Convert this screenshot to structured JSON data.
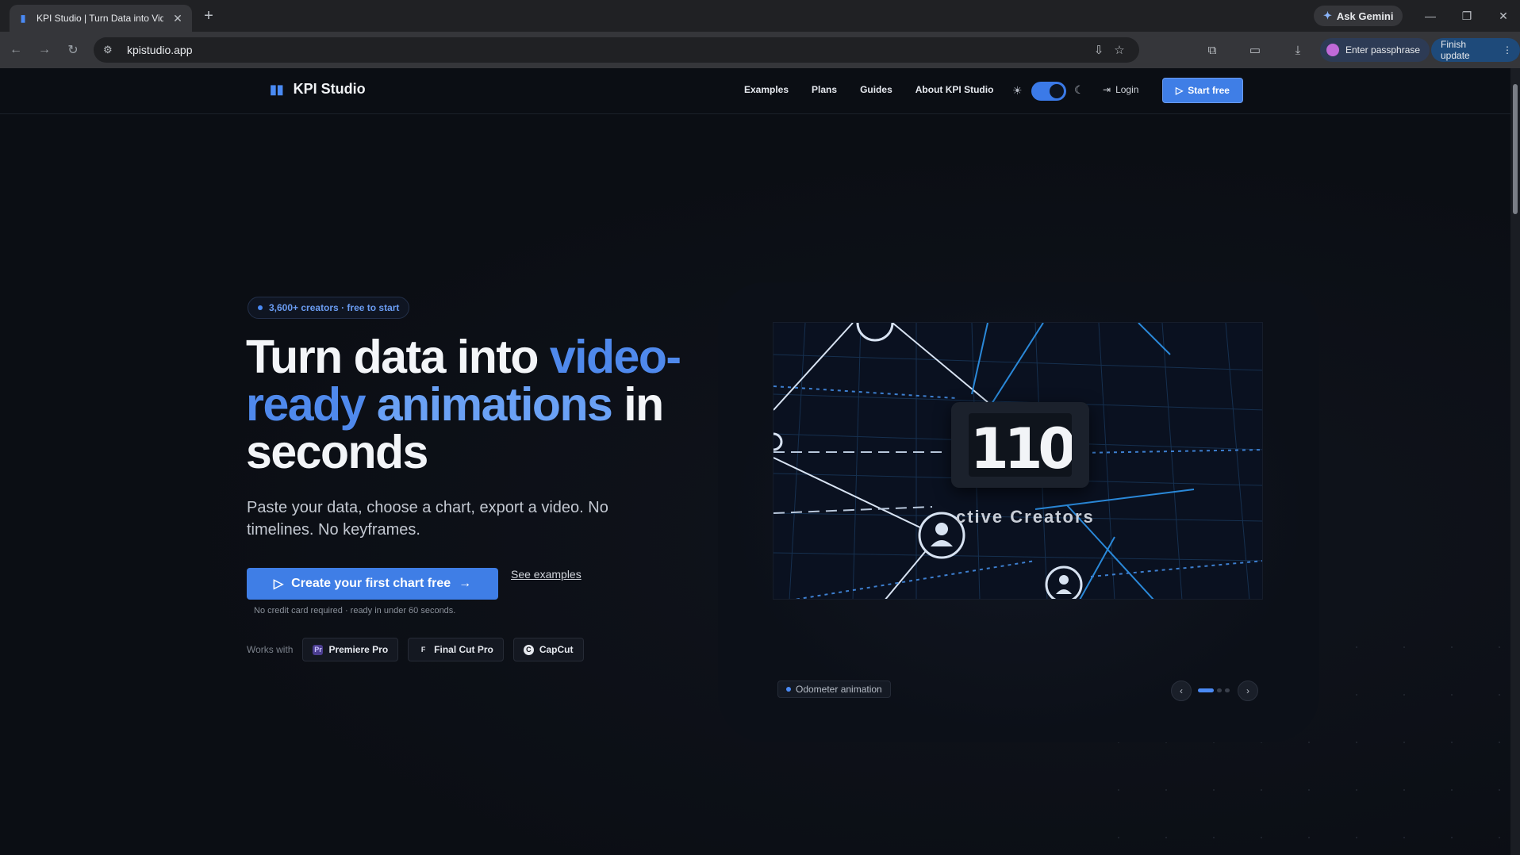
{
  "browser": {
    "tab_title": "KPI Studio | Turn Data into Vide",
    "favicon": "bar-chart-icon",
    "url": "kpistudio.app",
    "ask_gemini": "Ask Gemini",
    "passphrase": "Enter passphrase",
    "finish_update": "Finish update"
  },
  "site": {
    "brand": "KPI Studio",
    "nav": [
      "Examples",
      "Plans",
      "Guides",
      "About KPI Studio"
    ],
    "login": "Login",
    "start_free": "Start free",
    "theme_toggle_on": true
  },
  "hero": {
    "badge": "3,600+ creators · free to start",
    "headline_part1": "Turn data into ",
    "headline_accent1": "video-ready",
    "headline_part2": " ",
    "headline_accent2": "animations",
    "headline_part3": " in seconds",
    "subtext": "Paste your data, choose a chart, export a video. No timelines. No keyframes.",
    "cta": "Create your first chart free",
    "see_examples": "See examples",
    "fineprint": "No credit card required · ready in under 60 seconds.",
    "works_with_label": "Works with",
    "integrations": [
      {
        "name": "Premiere Pro",
        "icon": "Pr",
        "color": "#9999ff"
      },
      {
        "name": "Final Cut Pro",
        "icon": "F",
        "color": "#e6e9ef"
      },
      {
        "name": "CapCut",
        "icon": "C",
        "color": "#e6e9ef"
      }
    ]
  },
  "preview": {
    "odometer_digits": "110",
    "overlay_text": "ctive Creators",
    "label": "Odometer animation",
    "carousel_active": 0,
    "carousel_count": 3
  },
  "colors": {
    "accent": "#4a8af4",
    "background": "#0b0e14"
  }
}
